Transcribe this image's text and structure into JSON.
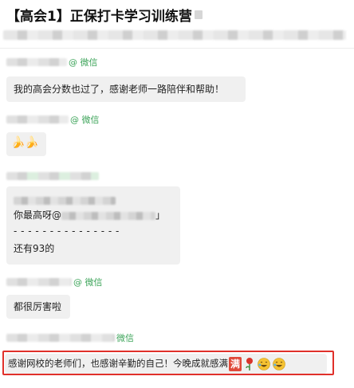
{
  "header": {
    "title": "【高会1】正保打卡学习训练营"
  },
  "messages": [
    {
      "tag": "@ 微信",
      "lines": [
        "我的高会分数也过了，感谢老师一路陪伴和帮助！"
      ]
    },
    {
      "tag": "@ 微信",
      "emoji": "🍌🍌"
    },
    {
      "tag": "",
      "quote_prefix": "你最高呀@",
      "quote_suffix": "」",
      "separator": "- - - - - - - - - - - - - - -",
      "reply": "还有93的"
    },
    {
      "tag": "@ 微信",
      "lines": [
        "都很厉害啦"
      ]
    },
    {
      "tag": "微信",
      "highlight_text": "感谢网校的老师们，也感谢辛勤的自己！今晚成就感满",
      "highlight_icon_char": "满",
      "trailing_icons": [
        "rose-icon",
        "laughing-tears-icon",
        "laughing-tears-icon"
      ]
    }
  ],
  "colors": {
    "tag_green": "#3da45a",
    "highlight_red": "#e0302a",
    "bubble_bg": "#f0f0f0"
  }
}
